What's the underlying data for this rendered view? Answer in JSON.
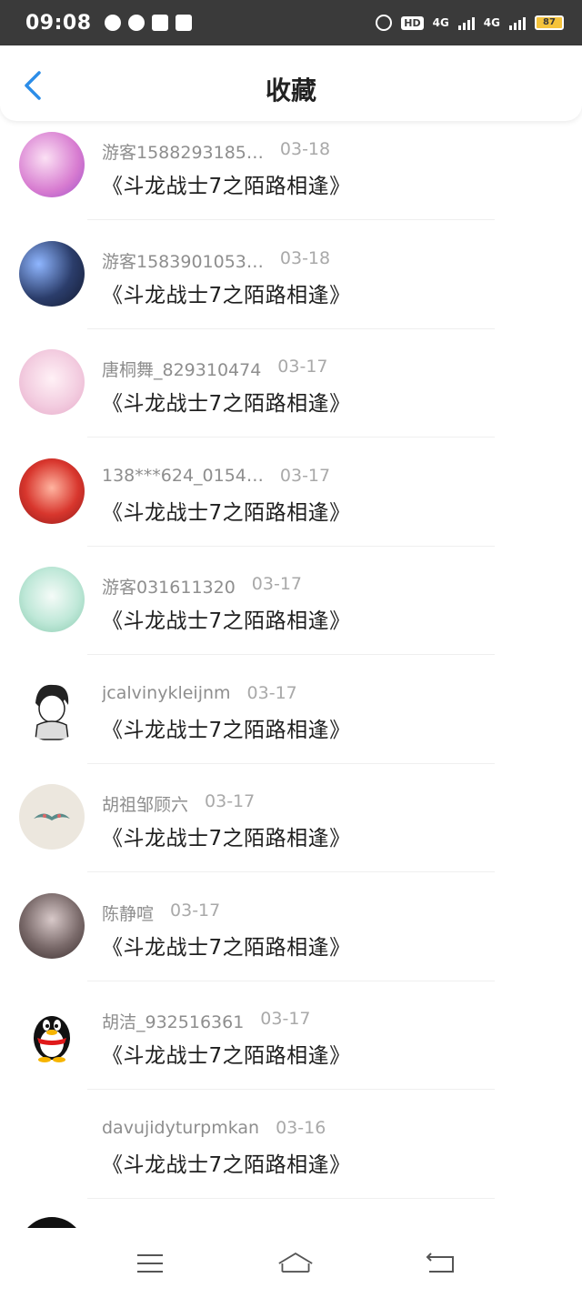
{
  "status_bar": {
    "time": "09:08",
    "hd": "HD",
    "net1": "4G",
    "net2": "4G",
    "battery": "87"
  },
  "header": {
    "title": "收藏"
  },
  "items": [
    {
      "user": "游客1588293185…",
      "date": "03-18",
      "book": "《斗龙战士7之陌路相逢》",
      "avatar_color": "#e7a6e0"
    },
    {
      "user": "游客1583901053…",
      "date": "03-18",
      "book": "《斗龙战士7之陌路相逢》",
      "avatar_color": "#2b3d6b"
    },
    {
      "user": "唐桐舞_829310474",
      "date": "03-17",
      "book": "《斗龙战士7之陌路相逢》",
      "avatar_color": "#f3cde0"
    },
    {
      "user": "138***624_0154…",
      "date": "03-17",
      "book": "《斗龙战士7之陌路相逢》",
      "avatar_color": "#d8362d"
    },
    {
      "user": "游客031611320",
      "date": "03-17",
      "book": "《斗龙战士7之陌路相逢》",
      "avatar_color": "#bfe8d8"
    },
    {
      "user": "jcalvinykleijnm",
      "date": "03-17",
      "book": "《斗龙战士7之陌路相逢》",
      "avatar_color": "#ffffff"
    },
    {
      "user": "胡祖邹顾六",
      "date": "03-17",
      "book": "《斗龙战士7之陌路相逢》",
      "avatar_color": "#ece7de"
    },
    {
      "user": "陈静喧",
      "date": "03-17",
      "book": "《斗龙战士7之陌路相逢》",
      "avatar_color": "#7a6a6a"
    },
    {
      "user": "胡洁_932516361",
      "date": "03-17",
      "book": "《斗龙战士7之陌路相逢》",
      "avatar_color": "#ffffff"
    },
    {
      "user": "davujidyturpmkan",
      "date": "03-16",
      "book": "《斗龙战士7之陌路相逢》",
      "avatar_color": "#ffffff"
    }
  ],
  "accent": "#2c8de8"
}
